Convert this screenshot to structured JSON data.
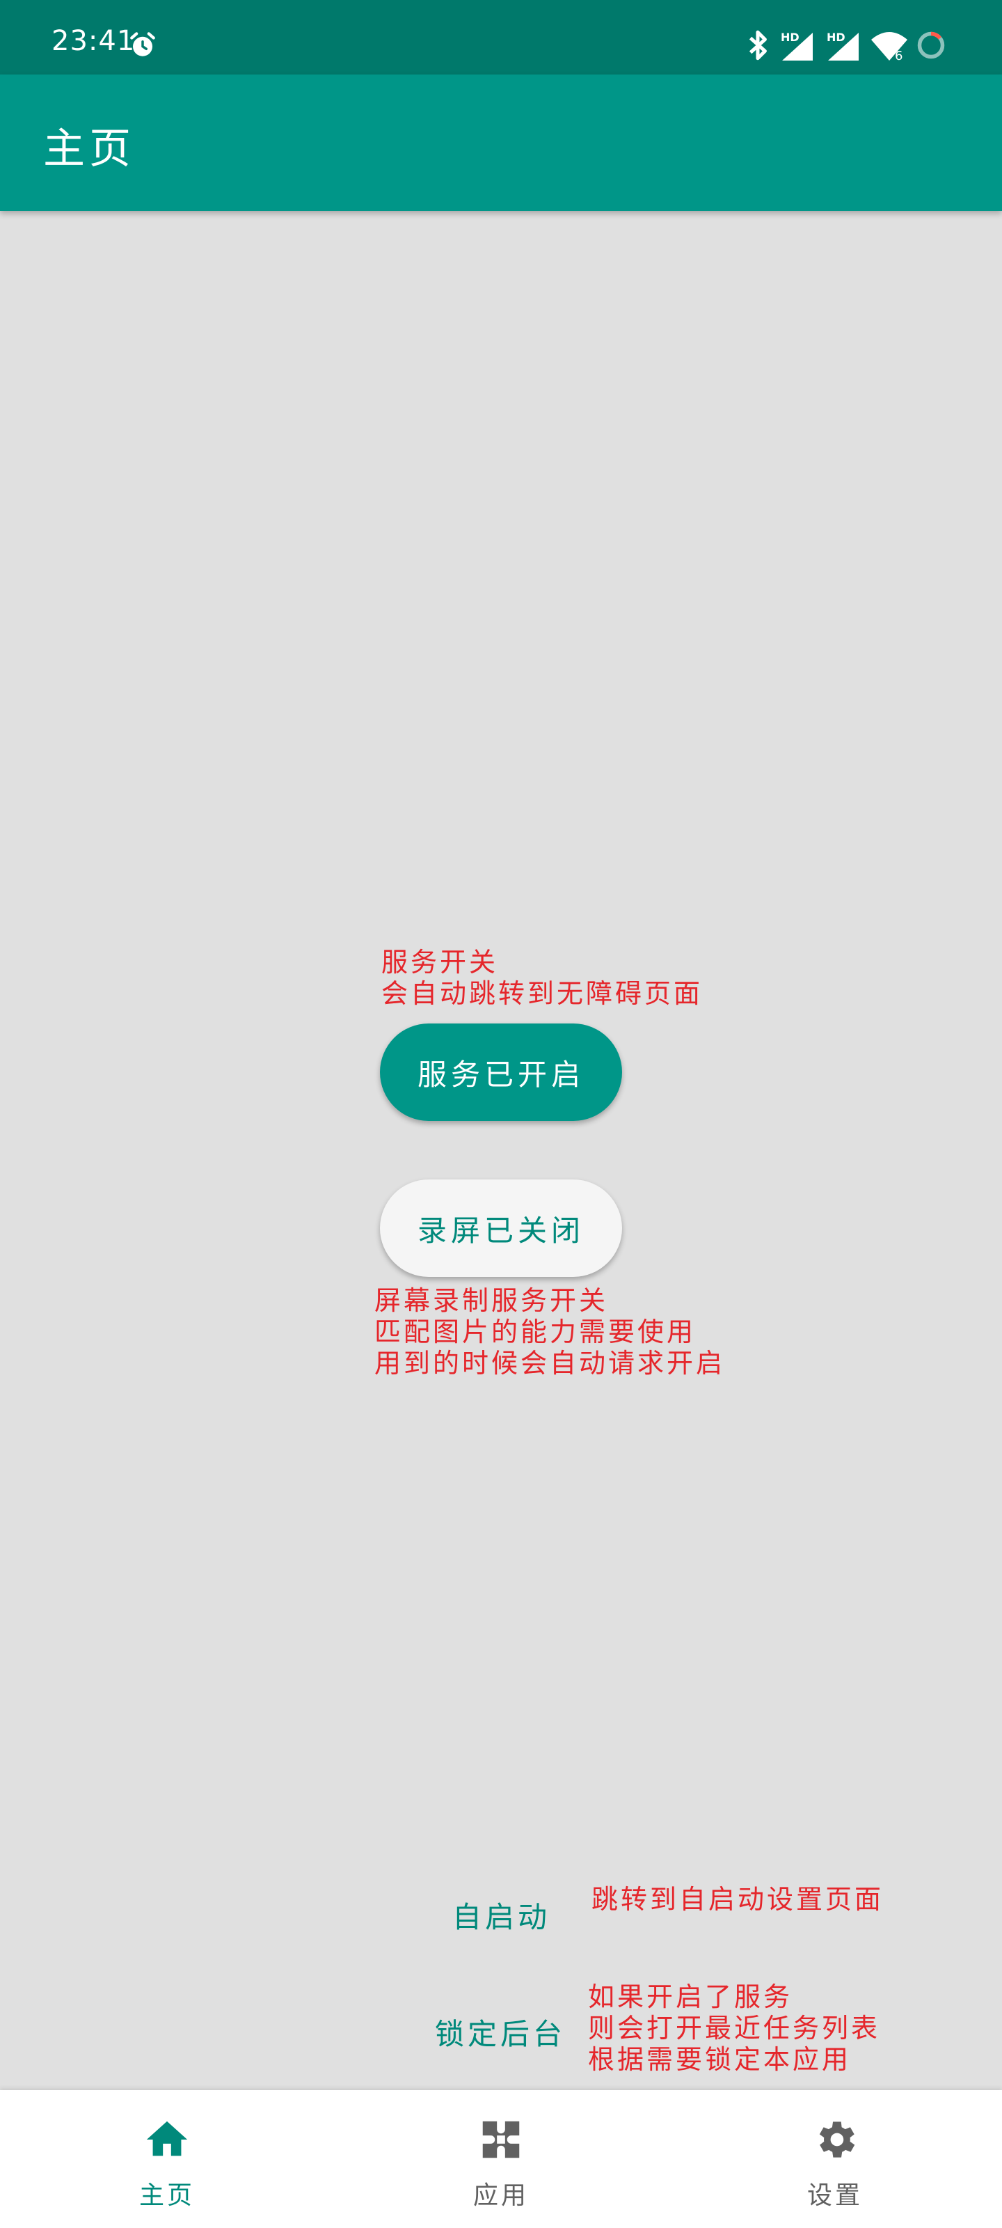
{
  "status_bar": {
    "time": "23:41",
    "icons": [
      "alarm-icon",
      "bluetooth-icon",
      "hd-signal-icon",
      "hd-signal-icon",
      "wifi-icon",
      "battery-ring-icon"
    ],
    "wifi_badge": "6"
  },
  "app_bar": {
    "title": "主页"
  },
  "notes": {
    "service": [
      "服务开关",
      "会自动跳转到无障碍页面"
    ],
    "record": [
      "屏幕录制服务开关",
      "匹配图片的能力需要使用",
      "用到的时候会自动请求开启"
    ],
    "autostart": [
      "跳转到自启动设置页面"
    ],
    "lock": [
      "如果开启了服务",
      "则会打开最近任务列表",
      "根据需要锁定本应用"
    ]
  },
  "buttons": {
    "service": "服务已开启",
    "record": "录屏已关闭",
    "autostart": "自启动",
    "lock": "锁定后台"
  },
  "bottom_nav": {
    "items": [
      {
        "label": "主页",
        "icon": "home-icon",
        "active": true
      },
      {
        "label": "应用",
        "icon": "apps-icon",
        "active": false
      },
      {
        "label": "设置",
        "icon": "settings-icon",
        "active": false
      }
    ]
  },
  "colors": {
    "status_bar": "#00796b",
    "primary": "#009688",
    "accent_text": "#00897b",
    "note_red": "#e5262b",
    "background": "#e0e0e0"
  }
}
